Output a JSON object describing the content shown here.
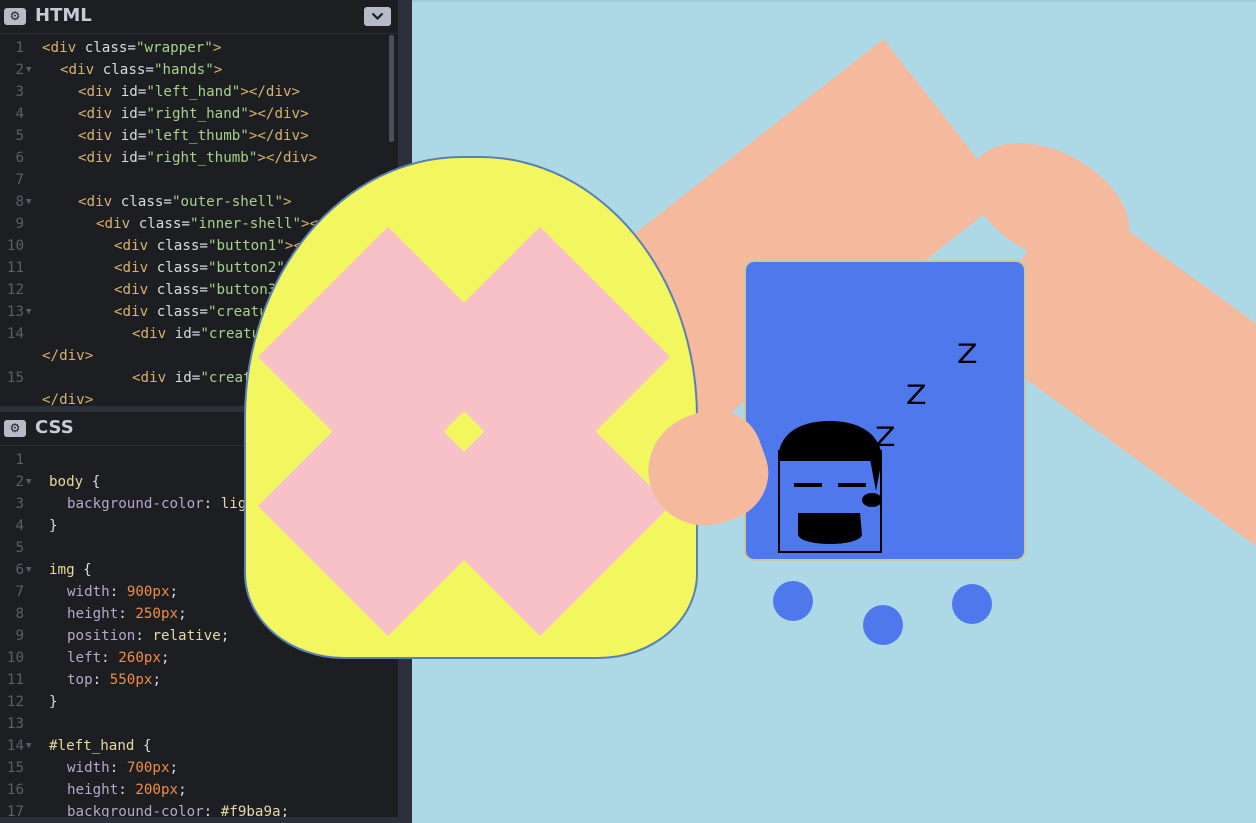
{
  "html_panel": {
    "title": "HTML",
    "lines": [
      {
        "n": "1",
        "fold": false,
        "indent": 0,
        "parts": [
          [
            "t",
            "<div "
          ],
          [
            "a",
            "class="
          ],
          [
            "s",
            "\"wrapper\""
          ],
          [
            "t",
            ">"
          ]
        ]
      },
      {
        "n": "2",
        "fold": true,
        "indent": 1,
        "parts": [
          [
            "t",
            "<div "
          ],
          [
            "a",
            "class="
          ],
          [
            "s",
            "\"hands\""
          ],
          [
            "t",
            ">"
          ]
        ]
      },
      {
        "n": "3",
        "fold": false,
        "indent": 2,
        "parts": [
          [
            "t",
            "<div "
          ],
          [
            "a",
            "id="
          ],
          [
            "s",
            "\"left_hand\""
          ],
          [
            "t",
            "></div>"
          ]
        ]
      },
      {
        "n": "4",
        "fold": false,
        "indent": 2,
        "parts": [
          [
            "t",
            "<div "
          ],
          [
            "a",
            "id="
          ],
          [
            "s",
            "\"right_hand\""
          ],
          [
            "t",
            "></div>"
          ]
        ]
      },
      {
        "n": "5",
        "fold": false,
        "indent": 2,
        "parts": [
          [
            "t",
            "<div "
          ],
          [
            "a",
            "id="
          ],
          [
            "s",
            "\"left_thumb\""
          ],
          [
            "t",
            "></div>"
          ]
        ]
      },
      {
        "n": "6",
        "fold": false,
        "indent": 2,
        "parts": [
          [
            "t",
            "<div "
          ],
          [
            "a",
            "id="
          ],
          [
            "s",
            "\"right_thumb\""
          ],
          [
            "t",
            "></div>"
          ]
        ]
      },
      {
        "n": "7",
        "fold": false,
        "indent": 0,
        "parts": []
      },
      {
        "n": "8",
        "fold": true,
        "indent": 2,
        "parts": [
          [
            "t",
            "<div "
          ],
          [
            "a",
            "class="
          ],
          [
            "s",
            "\"outer-shell\""
          ],
          [
            "t",
            ">"
          ]
        ]
      },
      {
        "n": "9",
        "fold": false,
        "indent": 3,
        "parts": [
          [
            "t",
            "<div "
          ],
          [
            "a",
            "class="
          ],
          [
            "s",
            "\"inner-shell\""
          ],
          [
            "t",
            "></div>"
          ]
        ]
      },
      {
        "n": "10",
        "fold": false,
        "indent": 4,
        "parts": [
          [
            "t",
            "<div "
          ],
          [
            "a",
            "class="
          ],
          [
            "s",
            "\"button1\""
          ],
          [
            "t",
            "></div>"
          ]
        ]
      },
      {
        "n": "11",
        "fold": false,
        "indent": 4,
        "parts": [
          [
            "t",
            "<div "
          ],
          [
            "a",
            "class="
          ],
          [
            "s",
            "\"button2\""
          ],
          [
            "t",
            "></div>"
          ]
        ]
      },
      {
        "n": "12",
        "fold": false,
        "indent": 4,
        "parts": [
          [
            "t",
            "<div "
          ],
          [
            "a",
            "class="
          ],
          [
            "s",
            "\"button3\""
          ],
          [
            "t",
            "></div>"
          ]
        ]
      },
      {
        "n": "13",
        "fold": true,
        "indent": 4,
        "parts": [
          [
            "t",
            "<div "
          ],
          [
            "a",
            "class="
          ],
          [
            "s",
            "\"creature\""
          ],
          [
            "t",
            ">"
          ]
        ]
      },
      {
        "n": "14",
        "fold": false,
        "indent": 5,
        "parts": [
          [
            "t",
            "<div "
          ],
          [
            "a",
            "id="
          ],
          [
            "s",
            "\"creature_body\""
          ],
          [
            "t",
            ">"
          ]
        ]
      },
      {
        "n": "",
        "fold": false,
        "indent": 0,
        "parts": [
          [
            "t",
            "</div>"
          ]
        ]
      },
      {
        "n": "15",
        "fold": false,
        "indent": 5,
        "parts": [
          [
            "t",
            "<div "
          ],
          [
            "a",
            "id="
          ],
          [
            "s",
            "\"creature_eye1\""
          ],
          [
            "t",
            ">"
          ]
        ]
      },
      {
        "n": "",
        "fold": false,
        "indent": 0,
        "parts": [
          [
            "t",
            "</div>"
          ]
        ]
      }
    ]
  },
  "css_panel": {
    "title": "CSS",
    "lines": [
      {
        "n": "1",
        "fold": false,
        "indent": 0,
        "parts": []
      },
      {
        "n": "2",
        "fold": true,
        "indent": 0,
        "parts": [
          [
            "sel",
            "body "
          ],
          [
            "pn",
            "{"
          ]
        ]
      },
      {
        "n": "3",
        "fold": false,
        "indent": 1,
        "parts": [
          [
            "p",
            "background-color"
          ],
          [
            "pn",
            ": "
          ],
          [
            "v",
            "lightblue"
          ],
          [
            "pn",
            ";"
          ]
        ]
      },
      {
        "n": "4",
        "fold": false,
        "indent": 0,
        "parts": [
          [
            "pn",
            "}"
          ]
        ]
      },
      {
        "n": "5",
        "fold": false,
        "indent": 0,
        "parts": []
      },
      {
        "n": "6",
        "fold": true,
        "indent": 0,
        "parts": [
          [
            "sel",
            "img "
          ],
          [
            "pn",
            "{"
          ]
        ]
      },
      {
        "n": "7",
        "fold": false,
        "indent": 1,
        "parts": [
          [
            "p",
            "width"
          ],
          [
            "pn",
            ": "
          ],
          [
            "n",
            "900px"
          ],
          [
            "pn",
            ";"
          ]
        ]
      },
      {
        "n": "8",
        "fold": false,
        "indent": 1,
        "parts": [
          [
            "p",
            "height"
          ],
          [
            "pn",
            ": "
          ],
          [
            "n",
            "250px"
          ],
          [
            "pn",
            ";"
          ]
        ]
      },
      {
        "n": "9",
        "fold": false,
        "indent": 1,
        "parts": [
          [
            "p",
            "position"
          ],
          [
            "pn",
            ": "
          ],
          [
            "v",
            "relative"
          ],
          [
            "pn",
            ";"
          ]
        ]
      },
      {
        "n": "10",
        "fold": false,
        "indent": 1,
        "parts": [
          [
            "p",
            "left"
          ],
          [
            "pn",
            ": "
          ],
          [
            "n",
            "260px"
          ],
          [
            "pn",
            ";"
          ]
        ]
      },
      {
        "n": "11",
        "fold": false,
        "indent": 1,
        "parts": [
          [
            "p",
            "top"
          ],
          [
            "pn",
            ": "
          ],
          [
            "n",
            "550px"
          ],
          [
            "pn",
            ";"
          ]
        ]
      },
      {
        "n": "12",
        "fold": false,
        "indent": 0,
        "parts": [
          [
            "pn",
            "}"
          ]
        ]
      },
      {
        "n": "13",
        "fold": false,
        "indent": 0,
        "parts": []
      },
      {
        "n": "14",
        "fold": true,
        "indent": 0,
        "parts": [
          [
            "sel",
            "#left_hand "
          ],
          [
            "pn",
            "{"
          ]
        ]
      },
      {
        "n": "15",
        "fold": false,
        "indent": 1,
        "parts": [
          [
            "p",
            "width"
          ],
          [
            "pn",
            ": "
          ],
          [
            "n",
            "700px"
          ],
          [
            "pn",
            ";"
          ]
        ]
      },
      {
        "n": "16",
        "fold": false,
        "indent": 1,
        "parts": [
          [
            "p",
            "height"
          ],
          [
            "pn",
            ": "
          ],
          [
            "n",
            "200px"
          ],
          [
            "pn",
            ";"
          ]
        ]
      },
      {
        "n": "17",
        "fold": false,
        "indent": 1,
        "parts": [
          [
            "p",
            "background-color"
          ],
          [
            "pn",
            ": "
          ],
          [
            "v",
            "#f9ba9a"
          ],
          [
            "pn",
            ";"
          ]
        ]
      }
    ]
  },
  "preview": {
    "sleep_letters": [
      "Z",
      "Z",
      "Z"
    ]
  },
  "colors": {
    "background": "#add8e6",
    "skin": "#f5b99d",
    "shell": "#f3f75f",
    "diamond": "#f8c1c8",
    "screen": "#5078ed"
  }
}
